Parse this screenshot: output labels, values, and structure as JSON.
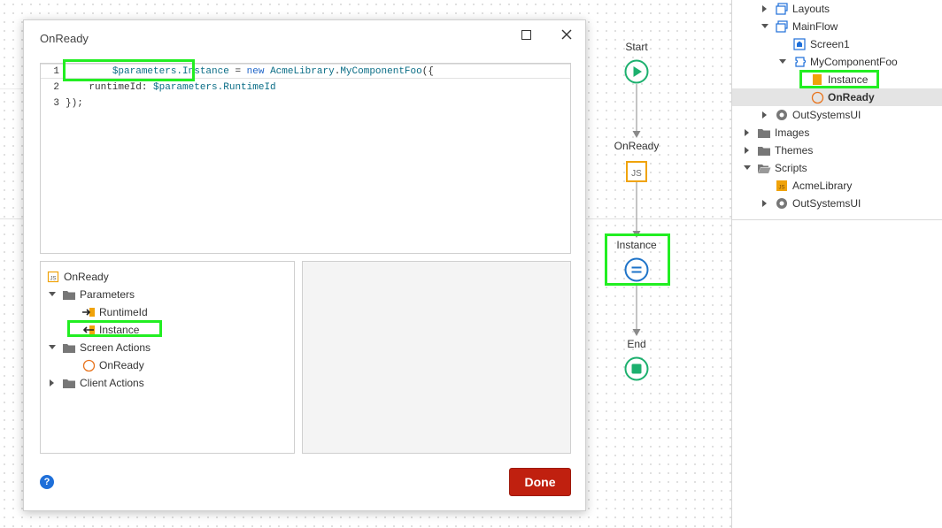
{
  "dialog": {
    "title": "OnReady",
    "done_label": "Done",
    "help_label": "?",
    "code": {
      "line_numbers": [
        "1",
        "2",
        "3"
      ],
      "line1": {
        "param": "$parameters.Instance",
        "assign": " = ",
        "kw": "new",
        "space": " ",
        "lib": "AcmeLibrary",
        "dot": ".",
        "cls": "MyComponentFoo",
        "end": "({"
      },
      "line2": {
        "indent": "    ",
        "key": "runtimeId: ",
        "param": "$parameters.RuntimeId"
      },
      "line3": {
        "text": "});"
      }
    },
    "tree": {
      "root": "OnReady",
      "parameters": "Parameters",
      "runtime_id": "RuntimeId",
      "instance": "Instance",
      "screen_actions": "Screen Actions",
      "on_ready": "OnReady",
      "client_actions": "Client Actions"
    }
  },
  "flow": {
    "start": "Start",
    "on_ready": "OnReady",
    "js_badge": "JS",
    "instance": "Instance",
    "end": "End"
  },
  "tree_panel": {
    "layouts": "Layouts",
    "main_flow": "MainFlow",
    "screen1": "Screen1",
    "component": "MyComponentFoo",
    "instance": "Instance",
    "on_ready": "OnReady",
    "outsystems_ui_1": "OutSystemsUI",
    "images": "Images",
    "themes": "Themes",
    "scripts": "Scripts",
    "acme_library": "AcmeLibrary",
    "outsystems_ui_2": "OutSystemsUI",
    "js_badge": "JS"
  },
  "colors": {
    "highlight": "#22ee22",
    "done_button": "#c0200f",
    "flow_green": "#1cb06e",
    "flow_blue": "#1e73c8",
    "js_orange": "#f0a30a"
  },
  "icons": [
    "close-icon",
    "maximize-icon",
    "help-icon",
    "folder-icon",
    "input-param-icon",
    "output-param-icon",
    "client-action-icon",
    "js-icon",
    "play-icon",
    "stop-icon",
    "assign-icon",
    "screen-icon",
    "component-icon",
    "module-icon",
    "flow-icon"
  ]
}
